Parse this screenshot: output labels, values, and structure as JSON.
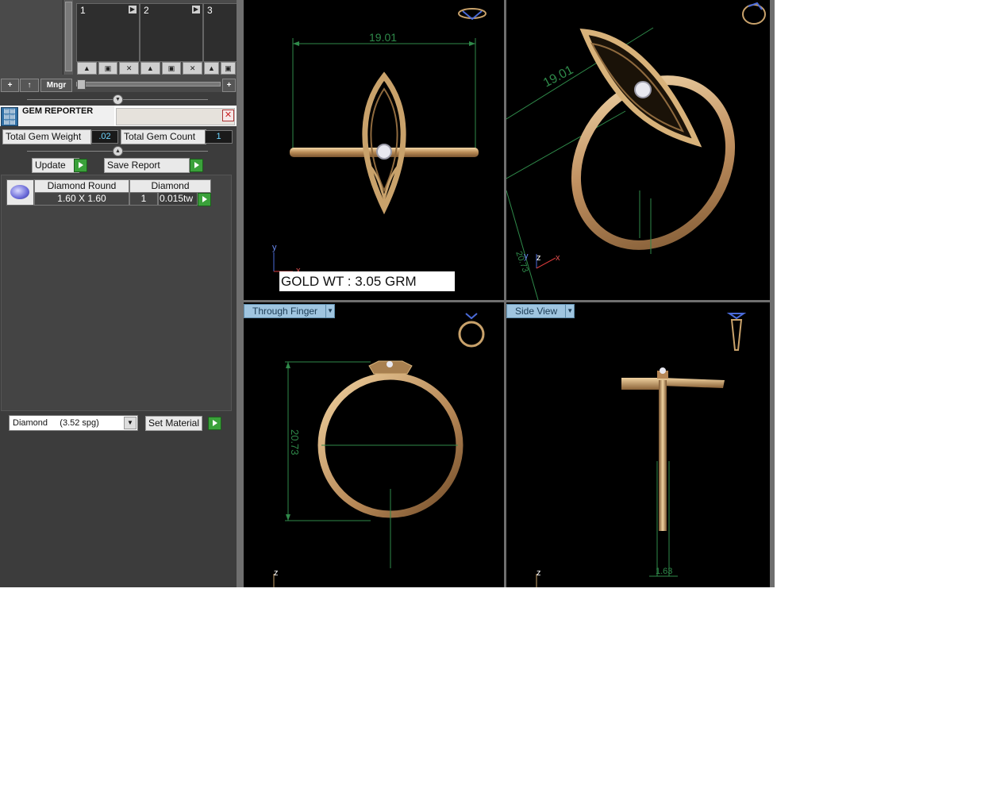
{
  "thumbnails": [
    {
      "num": "1"
    },
    {
      "num": "2"
    },
    {
      "num": "3"
    }
  ],
  "toolbar": {
    "add": "+",
    "up": "↑",
    "mngr": "Mngr",
    "add2": "+"
  },
  "gem_reporter": {
    "title": "GEM REPORTER",
    "total_weight_label": "Total Gem Weight",
    "total_weight_value": ".02",
    "total_count_label": "Total Gem Count",
    "total_count_value": "1",
    "update_label": "Update",
    "save_report_label": "Save Report",
    "table": {
      "col1_header": "Diamond Round",
      "col2_header": "Diamond",
      "size": "1.60 X 1.60",
      "count": "1",
      "weight": "0.015tw"
    },
    "material_select": "Diamond     (3.52 spg)",
    "set_material_label": "Set Material"
  },
  "viewports": {
    "top_left": {
      "dimension": "19.01",
      "gold_weight": "GOLD WT : 3.05 GRM",
      "axis_y": "y",
      "axis_x": "x"
    },
    "top_right": {
      "dimension": "19.01",
      "axis_z": "z",
      "axis_x": "x",
      "axis_y": "y",
      "small_dim": "20.73"
    },
    "bottom_left": {
      "tab": "Through Finger",
      "dimension": "20.73",
      "axis_z": "z"
    },
    "bottom_right": {
      "tab": "Side View",
      "dimension": "1.63",
      "axis_z": "z"
    }
  },
  "colors": {
    "gold": "#c9a26b",
    "dim_line": "#2f8a4a",
    "tab": "#9fc5e0",
    "panel": "#3c3c3c"
  }
}
